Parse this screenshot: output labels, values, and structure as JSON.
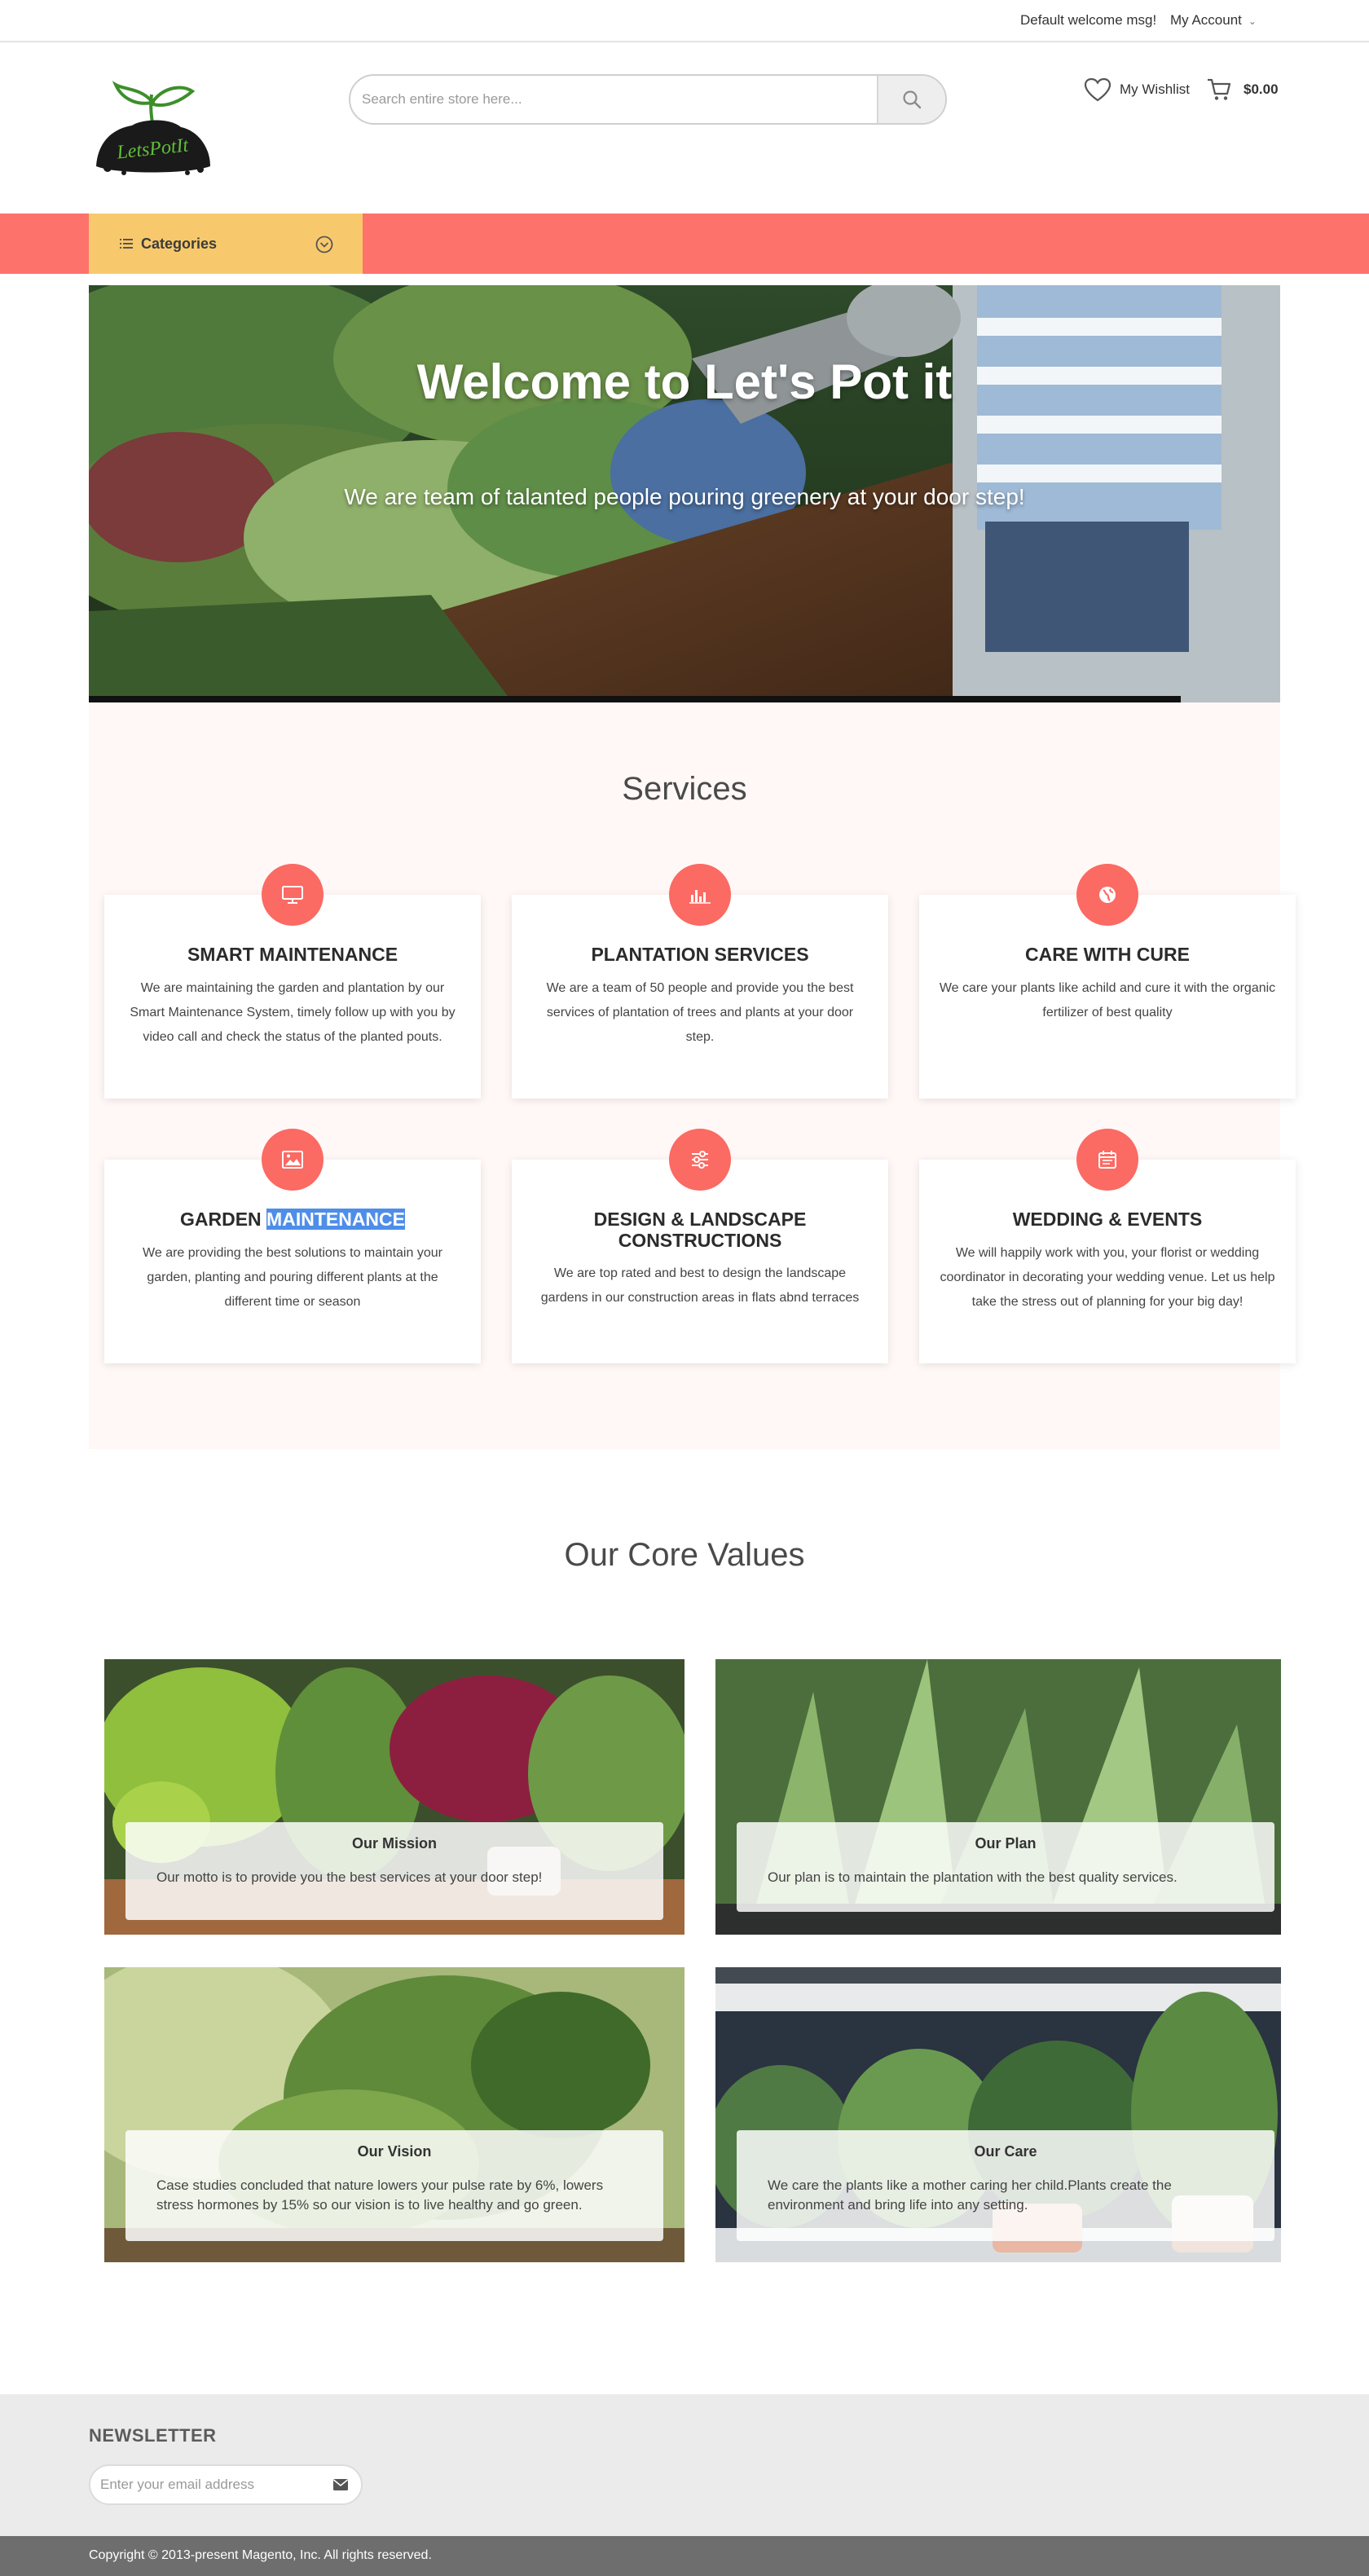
{
  "topbar": {
    "welcome": "Default welcome msg!",
    "account_label": "My Account",
    "account_icon": "chevron-down-icon"
  },
  "header": {
    "logo_text": "LetsPotIt",
    "search": {
      "placeholder": "Search entire store here...",
      "value": "",
      "icon": "search-icon"
    },
    "wishlist_label": "My Wishlist",
    "wishlist_icon": "heart-icon",
    "cart_icon": "cart-icon",
    "cart_total": "$0.00"
  },
  "nav": {
    "categories_label": "Categories",
    "categories_icon": "list-icon"
  },
  "hero": {
    "title": "Welcome to Let's Pot it",
    "subtitle": "We are team of talanted people pouring greenery at your door step!"
  },
  "services": {
    "title": "Services",
    "items": [
      {
        "title": "SMART MAINTENANCE",
        "icon": "monitor-icon",
        "text": "We are maintaining the garden and plantation by our Smart Maintenance System, timely follow up with you by video call and check the status of the planted pouts."
      },
      {
        "title": "PLANTATION SERVICES",
        "icon": "bar-chart-icon",
        "text": "We are a team of 50 people and provide you the best services of plantation of trees and plants at your door step."
      },
      {
        "title": "CARE WITH CURE",
        "icon": "globe-icon",
        "text": "We care your plants like achild and cure it with the organic fertilizer of best quality"
      },
      {
        "title_part1": "GARDEN ",
        "title_part2": "MAINTENANCE",
        "icon": "image-icon",
        "text": "We are providing the best solutions to maintain your garden, planting and pouring different plants at the different time or season"
      },
      {
        "title": "DESIGN & LANDSCAPE CONSTRUCTIONS",
        "icon": "sliders-icon",
        "text": "We are top rated and best to design the landscape gardens in our construction areas in flats abnd terraces"
      },
      {
        "title": "WEDDING & EVENTS",
        "icon": "calendar-icon",
        "text": "We will happily work with you, your florist or wedding coordinator in decorating your wedding venue. Let us help take the stress out of planning for your big day!"
      }
    ]
  },
  "core_values": {
    "title": "Our Core Values",
    "items": [
      {
        "title": "Our Mission",
        "text": "Our motto is to provide you the best services at your door step!"
      },
      {
        "title": "Our Plan",
        "text": "Our plan is to maintain the plantation with the best quality services."
      },
      {
        "title": "Our Vision",
        "text": "Case studies concluded that nature lowers your pulse rate by 6%, lowers stress hormones by 15% so our vision is to live healthy and go green."
      },
      {
        "title": "Our Care",
        "text": "We care the plants like a mother caring her child.Plants create the environment and bring life into any setting."
      }
    ]
  },
  "newsletter": {
    "title": "NEWSLETTER",
    "placeholder": "Enter your email address",
    "send_icon": "envelope-icon"
  },
  "footer": {
    "copyright": "Copyright © 2013-present Magento, Inc. All rights reserved."
  },
  "colors": {
    "accent": "#fd726b",
    "categories_bg": "#f8c96c",
    "icon_circle": "#fb6a63",
    "services_bg": "#fff8f6",
    "highlight": "#4e8ee8",
    "footer_bg": "#6e6e6e"
  }
}
